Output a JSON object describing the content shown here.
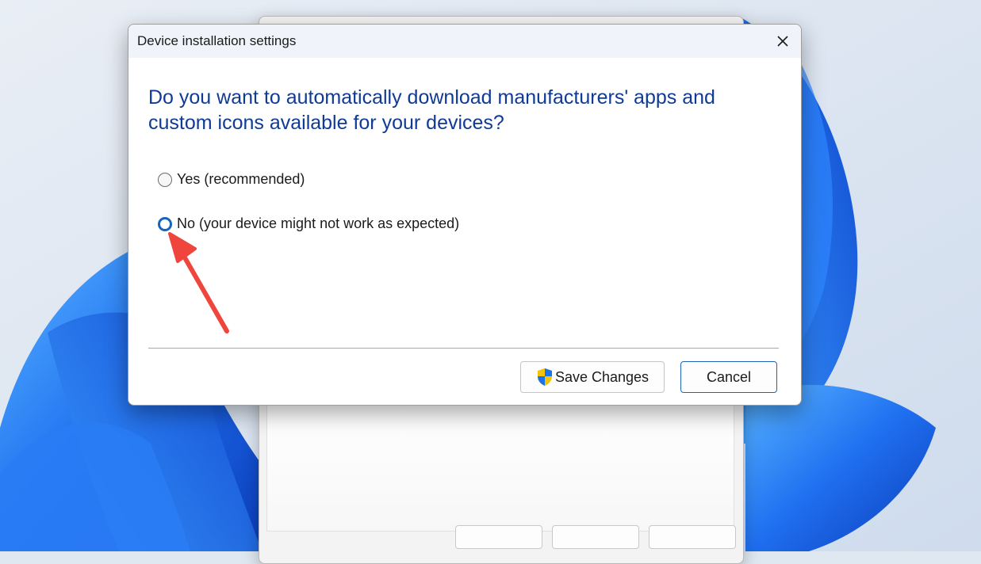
{
  "dialog": {
    "title": "Device installation settings",
    "question": "Do you want to automatically download manufacturers' apps and custom icons available for your devices?",
    "options": [
      {
        "label": "Yes (recommended)",
        "selected": false
      },
      {
        "label": "No (your device might not work as expected)",
        "selected": true
      }
    ],
    "buttons": {
      "save_label": "Save Changes",
      "cancel_label": "Cancel"
    }
  },
  "colors": {
    "question_text": "#0f3a96",
    "radio_selected": "#1565c0",
    "annotation_arrow": "#f0453d",
    "wallpaper_blue": "#1e6fe8"
  },
  "icons": [
    "close-icon",
    "uac-shield-icon",
    "annotation-arrow"
  ]
}
